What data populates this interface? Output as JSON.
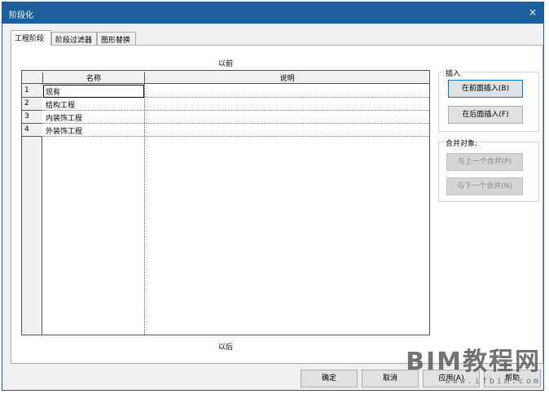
{
  "window": {
    "title": "阶段化",
    "close_icon": "×"
  },
  "tabs": [
    {
      "label": "工程阶段",
      "active": true
    },
    {
      "label": "阶段过滤器",
      "active": false
    },
    {
      "label": "图形替换",
      "active": false
    }
  ],
  "panel": {
    "before_label": "以前",
    "after_label": "以后"
  },
  "grid": {
    "columns": [
      "名称",
      "说明"
    ],
    "rows": [
      {
        "num": "1",
        "name": "现有",
        "desc": ""
      },
      {
        "num": "2",
        "name": "结构工程",
        "desc": ""
      },
      {
        "num": "3",
        "name": "内装饰工程",
        "desc": ""
      },
      {
        "num": "4",
        "name": "外装饰工程",
        "desc": ""
      }
    ]
  },
  "insert_group": {
    "title": "插入",
    "insert_before": "在前面插入(B)",
    "insert_after": "在后面插入(F)"
  },
  "merge_group": {
    "title": "合并对象:",
    "merge_prev": "与上一个合并(P)",
    "merge_next": "与下一个合并(N)"
  },
  "footer": {
    "ok": "确定",
    "cancel": "取消",
    "apply": "应用(A)",
    "help": "帮助"
  },
  "watermark": {
    "line1": "BIM教程网",
    "line2": "www.ifbim.com"
  }
}
